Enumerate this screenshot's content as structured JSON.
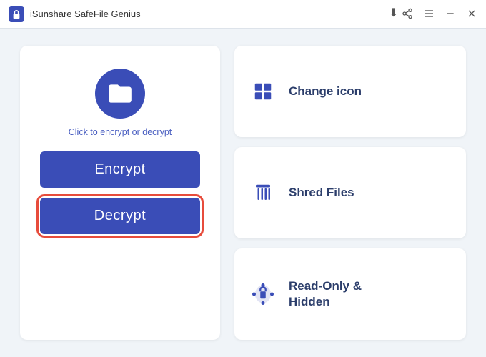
{
  "titleBar": {
    "title": "iSunshare SafeFile Genius",
    "logoAlt": "lock-icon"
  },
  "leftPanel": {
    "folderIconAlt": "folder-icon",
    "clickHint": "Click to encrypt or decrypt",
    "encryptLabel": "Encrypt",
    "decryptLabel": "Decrypt"
  },
  "rightPanel": {
    "cards": [
      {
        "id": "change-icon",
        "iconAlt": "grid-icon",
        "label": "Change icon"
      },
      {
        "id": "shred-files",
        "iconAlt": "shred-icon",
        "label": "Shred Files"
      },
      {
        "id": "read-only-hidden",
        "iconAlt": "readonly-icon",
        "label": "Read-Only &\nHidden"
      }
    ]
  },
  "windowControls": {
    "shareTitle": "Share",
    "menuTitle": "Menu",
    "minimizeTitle": "Minimize",
    "closeTitle": "Close"
  }
}
